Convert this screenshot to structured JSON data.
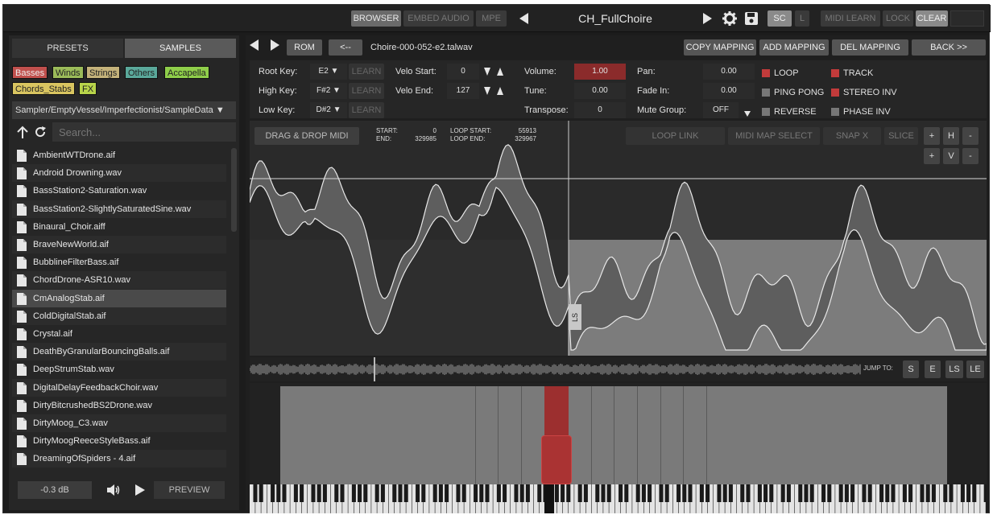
{
  "topbar": {
    "browser": "BROWSER",
    "embed_audio": "EMBED AUDIO",
    "mpe": "MPE",
    "preset_name": "CH_FullChoire",
    "sc": "SC",
    "l": "L",
    "midi_learn": "MIDI LEARN",
    "lock": "LOCK",
    "clear": "CLEAR"
  },
  "left": {
    "tabs": [
      "PRESETS",
      "SAMPLES"
    ],
    "categories": [
      {
        "label": "Basses",
        "color": "#c0504d"
      },
      {
        "label": "Winds",
        "color": "#9bbb59"
      },
      {
        "label": "Strings",
        "color": "#c4b27a"
      },
      {
        "label": "Others",
        "color": "#5aa89a"
      },
      {
        "label": "Accapella",
        "color": "#8fce4a"
      },
      {
        "label": "Chords_Stabs",
        "color": "#d9c560"
      },
      {
        "label": "FX",
        "color": "#b8d44a"
      }
    ],
    "path": "Sampler/EmptyVessel/Imperfectionist/SampleData ▼",
    "search_placeholder": "Search...",
    "files": [
      "AmbientWTDrone.aif",
      "Android Drowning.wav",
      "BassStation2-Saturation.wav",
      "BassStation2-SlightlySaturatedSine.wav",
      "Binaural_Choir.aiff",
      "BraveNewWorld.aif",
      "BubblineFilterBass.aif",
      "ChordDrone-ASR10.wav",
      "CmAnalogStab.aif",
      "ColdDigitalStab.aif",
      "Crystal.aif",
      "DeathByGranularBouncingBalls.aif",
      "DeepStrumStab.wav",
      "DigitalDelayFeedbackChoir.wav",
      "DirtyBitcrushedBS2Drone.wav",
      "DirtyMoog_C3.wav",
      "DirtyMoogReeceStyleBass.aif",
      "DreamingOfSpiders - 4.aif"
    ],
    "selected_file": "CmAnalogStab.aif",
    "volume": "-0.3 dB",
    "preview": "PREVIEW"
  },
  "right": {
    "rom": "ROM",
    "back_arrow": "<--",
    "sample_name": "Choire-000-052-e2.talwav",
    "copy_mapping": "COPY MAPPING",
    "add_mapping": "ADD MAPPING",
    "del_mapping": "DEL MAPPING",
    "back": "BACK >>",
    "params": {
      "root_key_label": "Root Key:",
      "root_key": "E2 ▼",
      "high_key_label": "High Key:",
      "high_key": "F#2 ▼",
      "low_key_label": "Low Key:",
      "low_key": "D#2 ▼",
      "learn": "LEARN",
      "velo_start_label": "Velo Start:",
      "velo_start": "0",
      "velo_end_label": "Velo End:",
      "velo_end": "127",
      "volume_label": "Volume:",
      "volume": "1.00",
      "tune_label": "Tune:",
      "tune": "0.00",
      "transpose_label": "Transpose:",
      "transpose": "0",
      "pan_label": "Pan:",
      "pan": "0.00",
      "fade_in_label": "Fade In:",
      "fade_in": "0.00",
      "mute_group_label": "Mute Group:",
      "mute_group": "OFF",
      "loop": "LOOP",
      "ping_pong": "PING PONG",
      "reverse": "REVERSE",
      "track": "TRACK",
      "stereo_inv": "STEREO INV",
      "phase_inv": "PHASE INV"
    },
    "drag_drop_midi": "DRAG & DROP MIDI",
    "start_label": "START:",
    "start": "0",
    "end_label": "END:",
    "end": "329985",
    "loop_start_label": "LOOP START:",
    "loop_start": "55913",
    "loop_end_label": "LOOP END:",
    "loop_end": "329967",
    "loop_link": "LOOP LINK",
    "midi_map_select": "MIDI MAP SELECT",
    "snap_x": "SNAP X",
    "slice": "SLICE",
    "zoom_plus": "+",
    "h": "H",
    "zoom_minus": "-",
    "v": "V",
    "ls_marker": "LS",
    "jump_to": "JUMP TO:",
    "jump_s": "S",
    "jump_e": "E",
    "jump_ls": "LS",
    "jump_le": "LE"
  }
}
